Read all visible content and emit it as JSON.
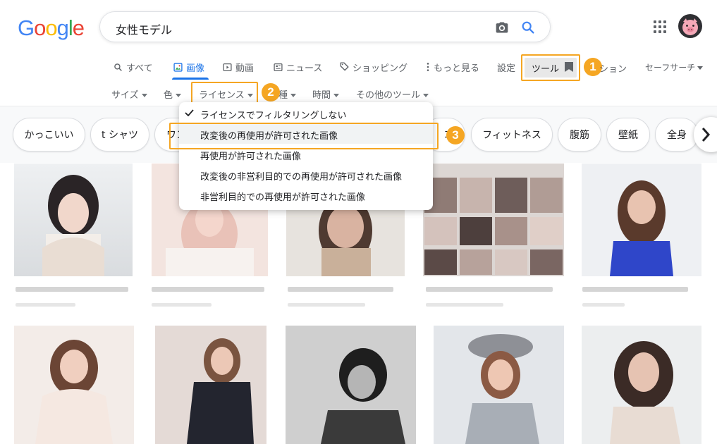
{
  "logo": {
    "g1": "G",
    "o1": "o",
    "o2": "o",
    "g2": "g",
    "l": "l",
    "e": "e"
  },
  "search": {
    "query": "女性モデル"
  },
  "tabs": {
    "all": "すべて",
    "images": "画像",
    "videos": "動画",
    "news": "ニュース",
    "shopping": "ショッピング",
    "more": "もっと見る",
    "settings": "設定",
    "tools": "ツール",
    "option": "ション",
    "safe_search": "セーフサーチ"
  },
  "filters": {
    "size": "サイズ",
    "color": "色",
    "license": "ライセンス",
    "type": "種",
    "time": "時間",
    "other": "その他のツール"
  },
  "badges": {
    "one": "1",
    "two": "2",
    "three": "3"
  },
  "chips": [
    "かっこいい",
    "t シャツ",
    "ワン",
    "コ",
    "フィットネス",
    "腹筋",
    "壁紙",
    "全身"
  ],
  "dropdown": {
    "items": [
      "ライセンスでフィルタリングしない",
      "改変後の再使用が許可された画像",
      "再使用が許可された画像",
      "改変後の非営利目的での再使用が許可された画像",
      "非営利目的での再使用が許可された画像"
    ]
  },
  "colors": {
    "accent": "#1a73e8",
    "highlight": "#f5a623",
    "hover": "#f1f3f4"
  }
}
